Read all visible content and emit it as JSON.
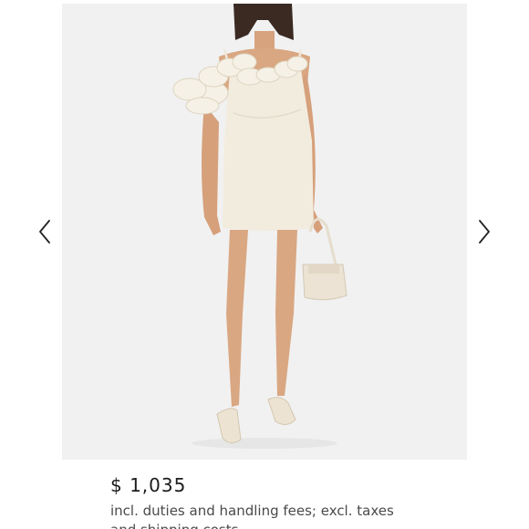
{
  "product": {
    "image_alt": "Model wearing an ivory mini dress with ruffled one-shoulder detail and a small ivory handbag",
    "price": "$ 1,035",
    "price_note": "incl. duties and handling fees; excl. taxes and shipping costs"
  },
  "gallery": {
    "prev_icon": "chevron-left-icon",
    "next_icon": "chevron-right-icon"
  },
  "colors": {
    "image_background": "#f1f1f1",
    "dress": "#f2ecdf",
    "text_primary": "#1b1b1b",
    "text_secondary": "#4a4a4a"
  }
}
